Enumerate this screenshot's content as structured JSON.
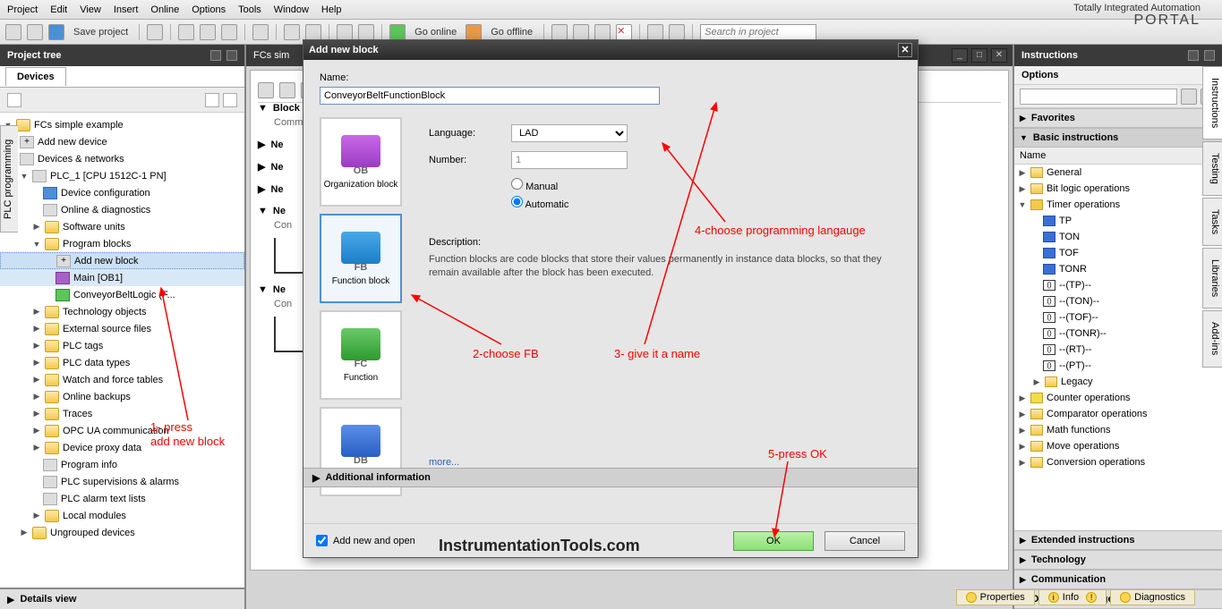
{
  "brand": {
    "line1": "Totally Integrated Automation",
    "line2": "PORTAL"
  },
  "menu": {
    "project": "Project",
    "edit": "Edit",
    "view": "View",
    "insert": "Insert",
    "online": "Online",
    "options": "Options",
    "tools": "Tools",
    "window": "Window",
    "help": "Help"
  },
  "toolbar": {
    "save": "Save project",
    "go_online": "Go online",
    "go_offline": "Go offline",
    "search_placeholder": "Search in project"
  },
  "left": {
    "title": "Project tree",
    "devices_tab": "Devices",
    "vtab": "PLC programming",
    "tree": {
      "root": "FCs  simple example",
      "add_device": "Add new device",
      "dev_net": "Devices & networks",
      "plc": "PLC_1 [CPU 1512C-1 PN]",
      "dev_cfg": "Device configuration",
      "online_diag": "Online & diagnostics",
      "sw_units": "Software units",
      "prog_blocks": "Program blocks",
      "add_block": "Add new block",
      "main_ob1": "Main [OB1]",
      "conveyor": "ConveyorBeltLogic (F...",
      "tech_obj": "Technology objects",
      "ext_src": "External source files",
      "plc_tags": "PLC tags",
      "plc_dtypes": "PLC data types",
      "watch": "Watch and force tables",
      "backups": "Online backups",
      "traces": "Traces",
      "opc": "OPC UA communication",
      "proxy": "Device proxy data",
      "prog_info": "Program info",
      "superv": "PLC supervisions & alarms",
      "alarm": "PLC alarm text lists",
      "local": "Local modules",
      "ungrouped": "Ungrouped devices"
    },
    "details": "Details view"
  },
  "center": {
    "title": "FCs  sim",
    "block_interface": "Block",
    "comment": "Comme",
    "ne": "Ne",
    "con": "Con"
  },
  "dialog": {
    "title": "Add new block",
    "name_label": "Name:",
    "name_value": "ConveyorBeltFunctionBlock",
    "language_label": "Language:",
    "language_value": "LAD",
    "number_label": "Number:",
    "number_value": "1",
    "manual": "Manual",
    "automatic": "Automatic",
    "desc_label": "Description:",
    "desc_text": "Function blocks are code blocks that store their values permanently in instance data blocks, so that they remain available after the block has been executed.",
    "types": {
      "ob": "Organization block",
      "fb": "Function block",
      "fc": "Function",
      "db": "Data block"
    },
    "more": "more...",
    "additional": "Additional information",
    "add_open": "Add new and open",
    "ok": "OK",
    "cancel": "Cancel"
  },
  "right": {
    "title": "Instructions",
    "options": "Options",
    "favorites": "Favorites",
    "basic": "Basic instructions",
    "col_name": "Name",
    "items": {
      "general": "General",
      "bitlogic": "Bit logic operations",
      "timer": "Timer operations",
      "tp": "TP",
      "ton": "TON",
      "tof": "TOF",
      "tonr": "TONR",
      "ntp": "--(TP)--",
      "nton": "--(TON)--",
      "ntof": "--(TOF)--",
      "ntonr": "--(TONR)--",
      "nrt": "--(RT)--",
      "npt": "--(PT)--",
      "legacy": "Legacy",
      "counter": "Counter operations",
      "comparator": "Comparator operations",
      "math": "Math functions",
      "move": "Move operations",
      "conversion": "Conversion operations"
    },
    "extended": "Extended instructions",
    "technology": "Technology",
    "communication": "Communication",
    "optional": "Optional packages",
    "vtabs": {
      "instr": "Instructions",
      "testing": "Testing",
      "tasks": "Tasks",
      "lib": "Libraries",
      "addins": "Add-ins"
    }
  },
  "status": {
    "properties": "Properties",
    "info": "Info",
    "diagnostics": "Diagnostics"
  },
  "annotations": {
    "a1a": "1- press",
    "a1b": "add new block",
    "a2": "2-choose FB",
    "a3": "3- give it a name",
    "a4": "4-choose programming langauge",
    "a5": "5-press OK"
  },
  "watermark": "InstrumentationTools.com"
}
